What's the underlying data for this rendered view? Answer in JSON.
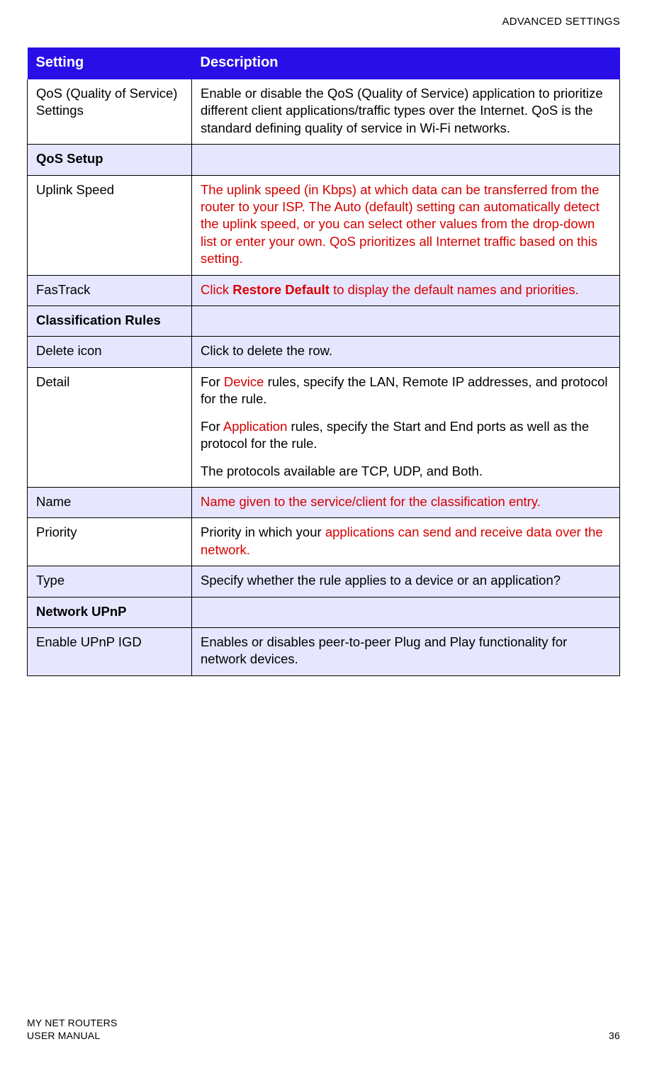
{
  "header": {
    "section_title": "ADVANCED SETTINGS"
  },
  "table": {
    "columns": {
      "setting": "Setting",
      "description": "Description"
    },
    "rows": {
      "qos_settings": {
        "setting": "QoS (Quality of Service) Settings",
        "desc": "Enable or disable the QoS (Quality of Service) application to prioritize different client applications/traffic types over the Internet. QoS is the standard defining quality of service in Wi-Fi networks."
      },
      "qos_setup_section": {
        "label": "QoS Setup"
      },
      "uplink_speed": {
        "setting": "Uplink Speed",
        "desc_red": "The uplink speed (in Kbps) at which data can be transferred from the router to your ISP. The Auto (default) setting can automatically detect the uplink speed, or you can select other values from the drop-down list or enter your own. QoS prioritizes all Internet traffic based on this setting."
      },
      "fastrack": {
        "setting": "FasTrack",
        "desc_pre": "Click ",
        "desc_bold": "Restore Default",
        "desc_post": " to display the default names and priorities."
      },
      "classification_section": {
        "label": "Classification Rules"
      },
      "delete_icon": {
        "setting": "Delete icon",
        "desc": "Click to delete the row."
      },
      "detail": {
        "setting": "Detail",
        "p1_pre": "For ",
        "p1_red": "Device",
        "p1_post": " rules, specify the LAN, Remote IP addresses, and protocol for the rule.",
        "p2_pre": "For ",
        "p2_red": "Application",
        "p2_post": " rules, specify the Start and End ports as well as the protocol for the rule.",
        "p3": "The protocols available are TCP, UDP, and Both."
      },
      "name": {
        "setting": "Name",
        "desc_red": "Name given to the service/client for the classification entry."
      },
      "priority": {
        "setting": "Priority",
        "desc_pre": "Priority in which your ",
        "desc_red": "applications can send and receive data over the network."
      },
      "type": {
        "setting": "Type",
        "desc": "Specify whether the rule applies to a device or an application?"
      },
      "network_upnp_section": {
        "label": "Network UPnP"
      },
      "enable_upnp": {
        "setting": "Enable UPnP IGD",
        "desc": "Enables or disables peer-to-peer Plug and Play functionality for network devices."
      }
    }
  },
  "footer": {
    "line1": "MY NET ROUTERS",
    "line2": "USER MANUAL",
    "page": "36"
  }
}
